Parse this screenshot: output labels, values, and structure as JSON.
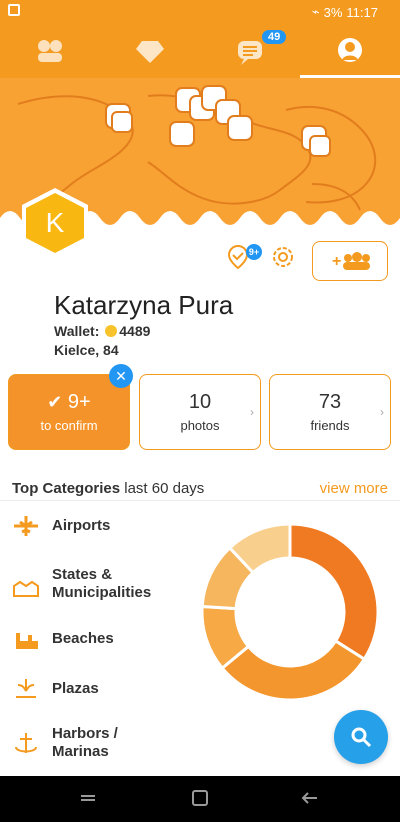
{
  "status_bar": {
    "battery": "3%",
    "time": "11:17"
  },
  "tabs": [
    {
      "name": "people",
      "badge": ""
    },
    {
      "name": "diamond",
      "badge": ""
    },
    {
      "name": "messages",
      "badge": "49"
    },
    {
      "name": "profile",
      "badge": ""
    }
  ],
  "avatar_letter": "K",
  "check_badge": "9+",
  "profile": {
    "name": "Katarzyna Pura",
    "wallet_label": "Wallet:",
    "wallet_value": "4489",
    "city": "Kielce, 84"
  },
  "stats": [
    {
      "number": "9+",
      "label": "to confirm"
    },
    {
      "number": "10",
      "label": "photos"
    },
    {
      "number": "73",
      "label": "friends"
    }
  ],
  "section": {
    "title_bold": "Top Categories",
    "title_rest": "last 60 days",
    "view_more": "view more"
  },
  "categories": [
    {
      "label": "Airports",
      "icon": "plane-icon"
    },
    {
      "label": "States &\nMunicipalities",
      "icon": "buildings-icon"
    },
    {
      "label": "Beaches",
      "icon": "sandcastle-icon"
    },
    {
      "label": "Plazas",
      "icon": "fountain-icon"
    },
    {
      "label": "Harbors /\nMarinas",
      "icon": "anchor-icon"
    }
  ],
  "chart_data": {
    "type": "pie",
    "values": [
      34,
      30,
      12,
      12,
      12
    ],
    "colors": [
      "#f07a22",
      "#f4962e",
      "#f6a944",
      "#f6b65e",
      "#f9cf8e"
    ]
  },
  "colors": {
    "accent": "#f39a1f",
    "blue": "#2196f3"
  }
}
